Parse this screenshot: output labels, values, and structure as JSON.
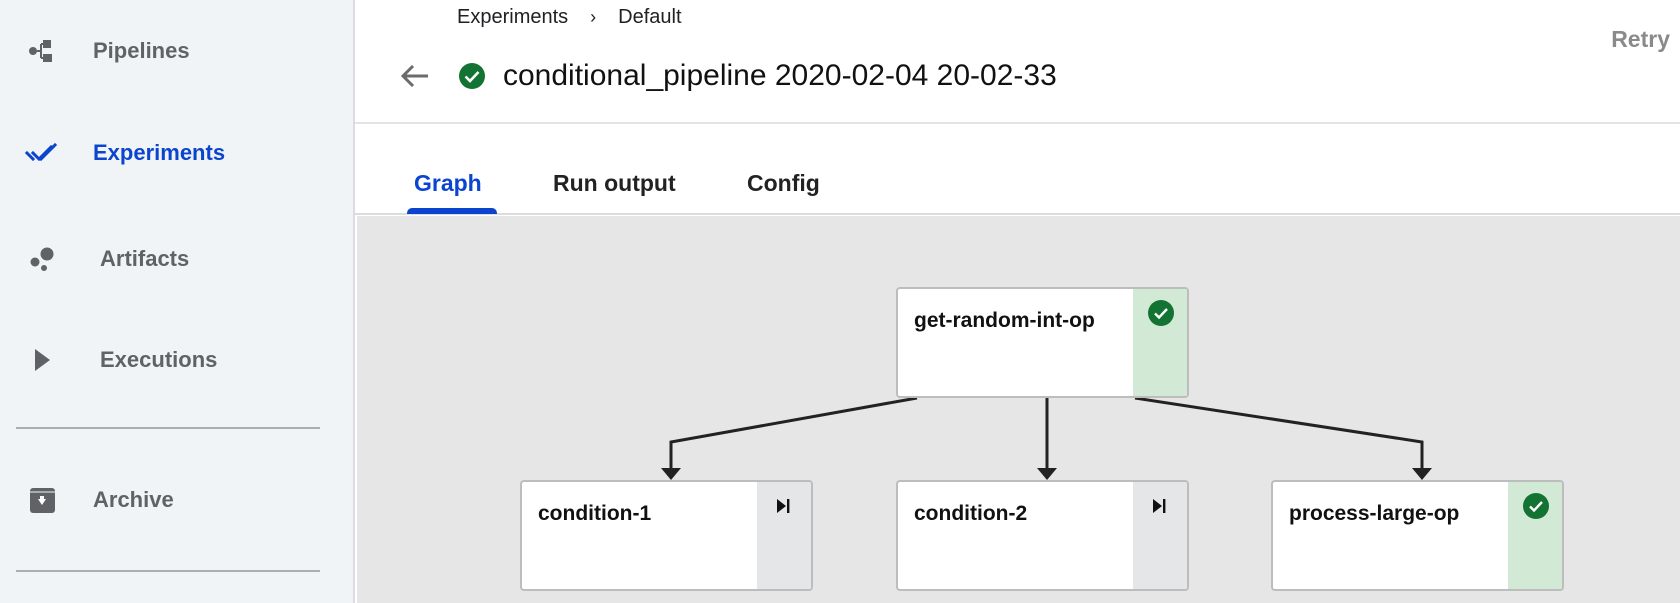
{
  "sidebar": {
    "items": [
      {
        "label": "Pipelines",
        "icon": "pipelines-icon",
        "active": false
      },
      {
        "label": "Experiments",
        "icon": "experiments-icon",
        "active": true
      },
      {
        "label": "Artifacts",
        "icon": "artifacts-icon",
        "active": false
      },
      {
        "label": "Executions",
        "icon": "executions-icon",
        "active": false
      },
      {
        "label": "Archive",
        "icon": "archive-icon",
        "active": false
      }
    ]
  },
  "header": {
    "breadcrumb": [
      {
        "label": "Experiments"
      },
      {
        "label": "Default"
      }
    ],
    "breadcrumb_separator": "›",
    "run_status": "success",
    "title": "conditional_pipeline 2020-02-04 20-02-33",
    "retry_label": "Retry"
  },
  "tabs": [
    {
      "label": "Graph",
      "active": true
    },
    {
      "label": "Run output",
      "active": false
    },
    {
      "label": "Config",
      "active": false
    }
  ],
  "graph": {
    "nodes": [
      {
        "id": "get-random-int-op",
        "label": "get-random-int-op",
        "status": "success",
        "status_icon": "check-circle-icon"
      },
      {
        "id": "condition-1",
        "label": "condition-1",
        "status": "skipped",
        "status_icon": "skip-next-icon"
      },
      {
        "id": "condition-2",
        "label": "condition-2",
        "status": "skipped",
        "status_icon": "skip-next-icon"
      },
      {
        "id": "process-large-op",
        "label": "process-large-op",
        "status": "success",
        "status_icon": "check-circle-icon"
      }
    ],
    "edges": [
      {
        "from": "get-random-int-op",
        "to": "condition-1"
      },
      {
        "from": "get-random-int-op",
        "to": "condition-2"
      },
      {
        "from": "get-random-int-op",
        "to": "process-large-op"
      }
    ]
  },
  "colors": {
    "accent": "#0b45cf",
    "success": "#137333",
    "success_bg": "#d2e9d6",
    "skipped_bg": "#e4e6e7",
    "sidebar_bg": "#f1f4f6",
    "graph_bg": "#e6e6e6"
  }
}
